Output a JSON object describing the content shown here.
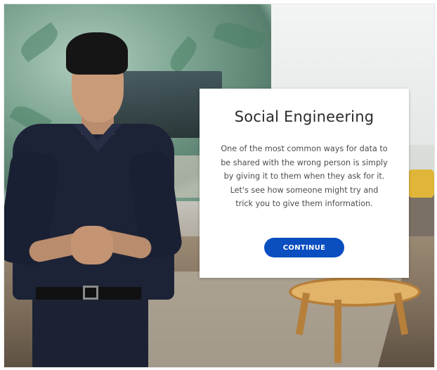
{
  "dialog": {
    "title": "Social Engineering",
    "body": "One of the most common ways for data to be shared with the wrong person is simply by giving it to them when they ask for it. Let's see how someone might try and trick you to give them information.",
    "continue_label": "CONTINUE"
  },
  "colors": {
    "button": "#0a4ec0",
    "card": "#ffffff"
  }
}
